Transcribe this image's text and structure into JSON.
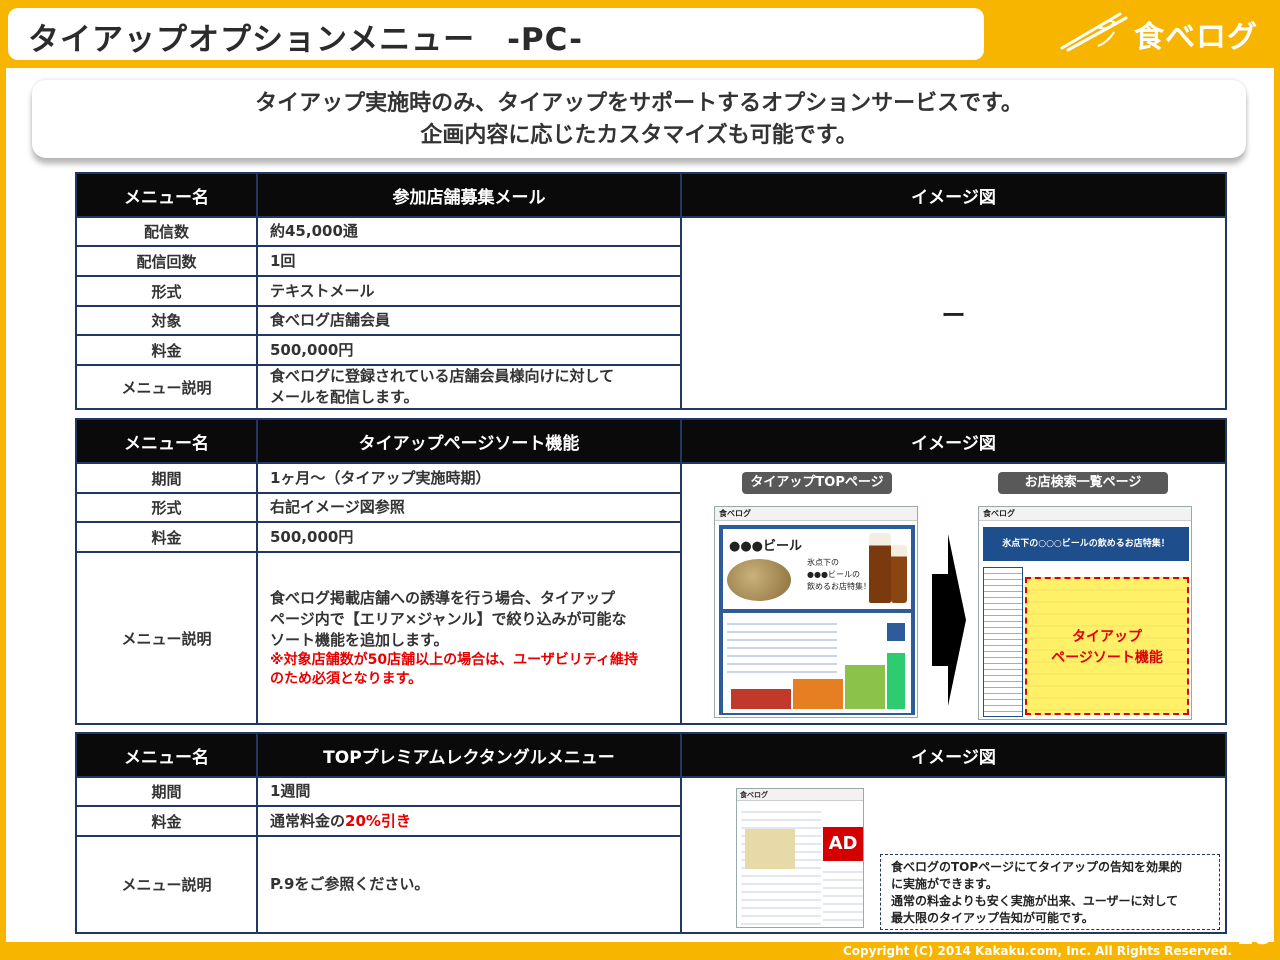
{
  "header": {
    "title": "タイアップオプションメニュー　-PC-",
    "logo_text": "食べログ"
  },
  "banner": {
    "line1": "タイアップ実施時のみ、タイアップをサポートするオプションサービスです。",
    "line2": "企画内容に応じたカスタマイズも可能です。"
  },
  "col_headers": {
    "menu_name": "メニュー名",
    "image": "イメージ図"
  },
  "table1": {
    "name": "参加店舗募集メール",
    "rows": [
      {
        "label": "配信数",
        "value": "約45,000通"
      },
      {
        "label": "配信回数",
        "value": "1回"
      },
      {
        "label": "形式",
        "value": "テキストメール"
      },
      {
        "label": "対象",
        "value": "食べログ店舗会員"
      },
      {
        "label": "料金",
        "value": "500,000円"
      }
    ],
    "desc_label": "メニュー説明",
    "desc_line1": "食べログに登録されている店舗会員様向けに対して",
    "desc_line2": "メールを配信します。",
    "image_placeholder": "ー"
  },
  "table2": {
    "name": "タイアップページソート機能",
    "rows": [
      {
        "label": "期間",
        "value": "1ヶ月～（タイアップ実施時期）"
      },
      {
        "label": "形式",
        "value": "右記イメージ図参照"
      },
      {
        "label": "料金",
        "value": "500,000円"
      }
    ],
    "desc_label": "メニュー説明",
    "desc_line1": "食べログ掲載店舗への誘導を行う場合、タイアップ",
    "desc_line2": "ページ内で【エリア×ジャンル】で絞り込みが可能な",
    "desc_line3": "ソート機能を追加します。",
    "note_line1": "※対象店舗数が50店舗以上の場合は、ユーザビリティ維持",
    "note_line2": "のため必須となります。",
    "img_label_left": "タイアップTOPページ",
    "img_label_right": "お店検索一覧ページ",
    "left_shot": {
      "logo": "食べログ",
      "heading": "●●●ビール",
      "caption1": "氷点下の",
      "caption2": "●●●ビールの",
      "caption3": "飲めるお店特集！"
    },
    "right_shot": {
      "logo": "食べログ",
      "banner": "氷点下の○○○ビールの飲めるお店特集！",
      "highlight1": "タイアップ",
      "highlight2": "ページソート機能"
    }
  },
  "table3": {
    "name": "TOPプレミアムレクタングルメニュー",
    "rows": [
      {
        "label": "期間",
        "value": "1週間"
      }
    ],
    "price_label": "料金",
    "price_prefix": "通常料金の",
    "price_red": "20%引き",
    "desc_label": "メニュー説明",
    "desc_value": "P.9をご参照ください。",
    "ad_text": "AD",
    "shot_logo": "食べログ",
    "desc_box": [
      "食べログのTOPページにてタイアップの告知を効果的",
      "に実施ができます。",
      "通常の料金よりも安く実施が出来、ユーザーに対して",
      "最大限のタイアップ告知が可能です。"
    ]
  },
  "footer": {
    "copyright": "Copyright (C) 2014 Kakaku.com, Inc. All Rights Reserved.",
    "page": "28"
  },
  "colors": {
    "brand_orange": "#f8b500",
    "table_header": "#0a0a0a",
    "border_navy": "#203864",
    "accent_red": "#e60000"
  }
}
